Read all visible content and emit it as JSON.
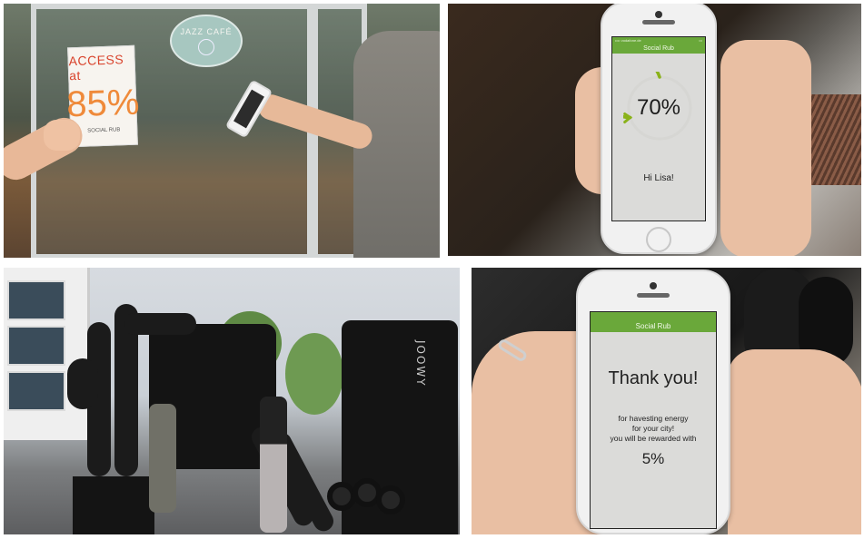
{
  "panel_top_left": {
    "sign_line1": "ACCESS at",
    "sign_line2": "85%",
    "sign_line3": "SOCIAL RUB",
    "cafe_name": "JAZZ CAFÉ"
  },
  "panel_top_right": {
    "app_title": "Social Rub",
    "status_left": "•••• vodafone.de",
    "status_right": "▭",
    "progress_value": 0.7,
    "percent_text": "70%",
    "greeting": "Hi Lisa!",
    "accent_color": "#8ab21a"
  },
  "panel_bottom_left": {
    "graffiti_text": "JOOWY"
  },
  "panel_bottom_right": {
    "app_title": "Social Rub",
    "title": "Thank you!",
    "message_lines": [
      "for havesting energy",
      "for your city!",
      "you will be rewarded with"
    ],
    "reward_percent": "5%"
  },
  "colors": {
    "app_bar": "#6aa83a",
    "sign_text": "#d9452e",
    "sign_percent": "#ef8a3a"
  }
}
